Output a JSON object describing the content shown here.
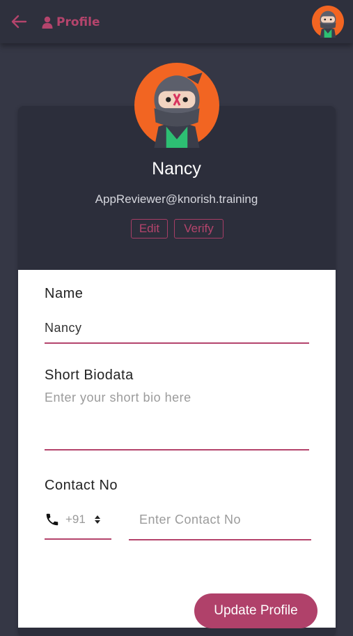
{
  "header": {
    "title": "Profile",
    "back_icon": "back-arrow-icon",
    "profile_icon": "person-icon",
    "avatar_icon": "ninja-avatar-icon"
  },
  "profile": {
    "name": "Nancy",
    "email": "AppReviewer@knorish.training",
    "edit_label": "Edit",
    "verify_label": "Verify",
    "avatar_icon": "ninja-avatar-icon"
  },
  "form": {
    "name_label": "Name",
    "name_value": "Nancy",
    "bio_label": "Short Biodata",
    "bio_placeholder": "Enter your short bio here",
    "contact_label": "Contact No",
    "country_code": "+91",
    "phone_icon": "phone-icon",
    "contact_placeholder": "Enter Contact No",
    "update_label": "Update Profile"
  },
  "colors": {
    "accent": "#b4446c",
    "background": "#353745",
    "card": "#2c2e3b",
    "avatar_ring": "#f26522"
  }
}
